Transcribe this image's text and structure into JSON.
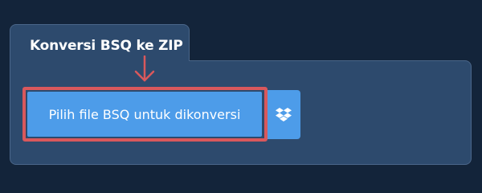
{
  "tab": {
    "title": "Konversi BSQ ke ZIP"
  },
  "upload": {
    "choose_file_label": "Pilih file BSQ untuk dikonversi",
    "cloud_icon": "dropbox-icon"
  },
  "colors": {
    "page_background": "#13243a",
    "panel_background": "#2d4a6d",
    "button_blue": "#4d9ce9",
    "highlight_red": "#d9585c"
  }
}
